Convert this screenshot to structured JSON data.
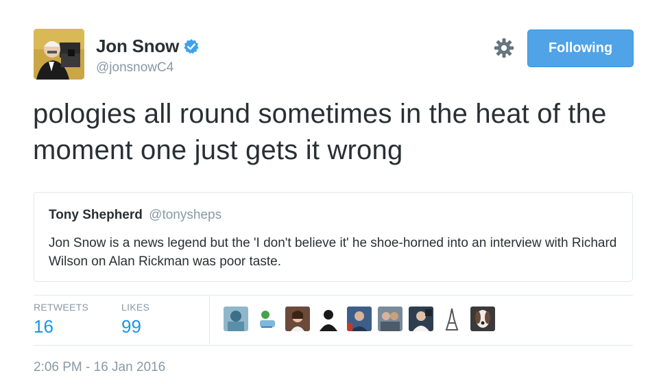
{
  "author": {
    "name": "Jon Snow",
    "handle": "@jonsnowC4",
    "verified": true
  },
  "actions": {
    "follow_label": "Following",
    "settings_icon": "gear-icon"
  },
  "tweet": {
    "text": "pologies all round sometimes in the heat of the moment one just gets it wrong"
  },
  "quoted": {
    "name": "Tony Shepherd",
    "handle": "@tonysheps",
    "text": "Jon Snow is a news legend but the 'I don't believe it' he shoe-horned into an interview with Richard Wilson on Alan Rickman was poor taste."
  },
  "stats": {
    "retweets_label": "RETWEETS",
    "retweets_value": "16",
    "likes_label": "LIKES",
    "likes_value": "99"
  },
  "timestamp": "2:06 PM - 16 Jan 2016",
  "colors": {
    "accent": "#1b95e0",
    "follow_button": "#4fa3e6",
    "muted": "#8899a6",
    "text": "#292f33"
  }
}
